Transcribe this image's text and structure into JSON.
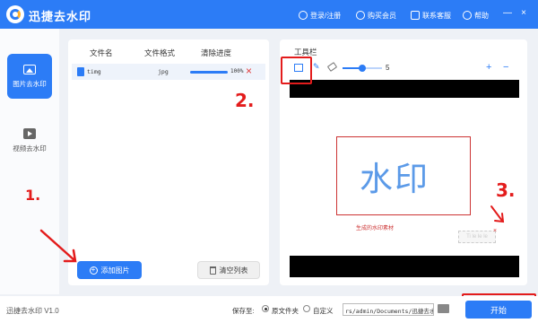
{
  "app": {
    "title": "迅捷去水印",
    "version": "迅捷去水印 V1.0"
  },
  "titlebar": {
    "login": "登录/注册",
    "buy": "购买会员",
    "support": "联系客服",
    "help": "帮助",
    "minimize": "—",
    "close": "×"
  },
  "sidebar": {
    "items": [
      {
        "label": "图片去水印",
        "icon": "image-icon",
        "active": true
      },
      {
        "label": "视频去水印",
        "icon": "video-icon",
        "active": false
      }
    ]
  },
  "file_list": {
    "columns": [
      "文件名",
      "文件格式",
      "清除进度"
    ],
    "rows": [
      {
        "name": "timg",
        "format": "jpg",
        "progress_text": "100%",
        "progress": 1.0
      }
    ],
    "add_button": "添加图片",
    "clear_button": "清空列表"
  },
  "toolbar": {
    "label": "工具栏",
    "brush_size": "5",
    "zoom_in": "+",
    "zoom_out": "−"
  },
  "canvas": {
    "watermark_text": "水印",
    "hint": "生成的水印素材",
    "mini_watermark": "Ti le le le",
    "mini_close": "×"
  },
  "annotations": {
    "step1": "1.",
    "step2": "2.",
    "step3": "3."
  },
  "statusbar": {
    "save_to": "保存至:",
    "option_original": "原文件夹",
    "option_custom": "自定义",
    "path": "rs/admin/Documents/迅捷去水印",
    "start": "开始"
  },
  "colors": {
    "accent": "#2c7cf6",
    "annotation": "#e31c1c"
  }
}
